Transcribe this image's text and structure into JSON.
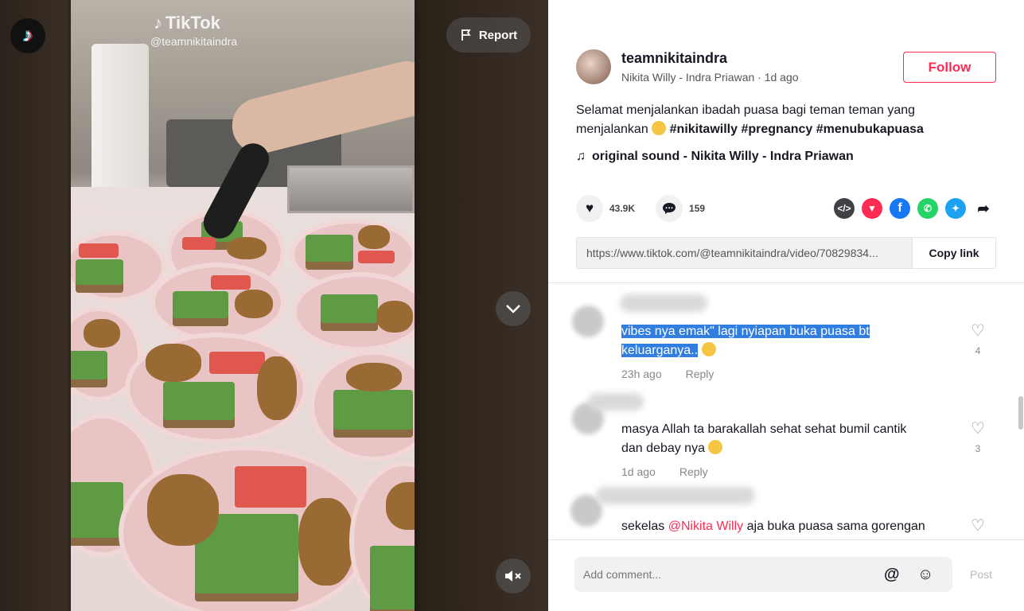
{
  "video": {
    "watermark_brand": "TikTok",
    "watermark_user": "@teamnikitaindra",
    "report_label": "Report"
  },
  "author": {
    "username": "teamnikitaindra",
    "display_name": "Nikita Willy - Indra Priawan",
    "posted": "1d ago",
    "follow_label": "Follow"
  },
  "description": {
    "text": "Selamat menjalankan ibadah puasa bagi teman teman yang menjalankan",
    "hashtags": [
      "#nikitawilly",
      "#pregnancy",
      "#menubukapuasa"
    ]
  },
  "sound": {
    "label": "original sound - Nikita Willy - Indra Priawan"
  },
  "stats": {
    "likes": "43.9K",
    "comments": "159"
  },
  "share": {
    "link": "https://www.tiktok.com/@teamnikitaindra/video/70829834...",
    "copy_label": "Copy link"
  },
  "comments": [
    {
      "text_line1": "vibes nya emak\" lagi nyiapan buka puasa bt",
      "text_line2": "keluarganya..",
      "time": "23h ago",
      "reply": "Reply",
      "likes": "4"
    },
    {
      "text_line1": "masya Allah ta barakallah sehat sehat bumil cantik",
      "text_line2": "dan debay nya",
      "time": "1d ago",
      "reply": "Reply",
      "likes": "3"
    },
    {
      "text_before": "sekelas ",
      "mention": "@Nikita Willy",
      "text_after": " aja buka puasa sama gorengan"
    }
  ],
  "composer": {
    "placeholder": "Add comment...",
    "post_label": "Post"
  },
  "colors": {
    "brand": "#fe2c55",
    "selection": "#2f7ee0"
  }
}
